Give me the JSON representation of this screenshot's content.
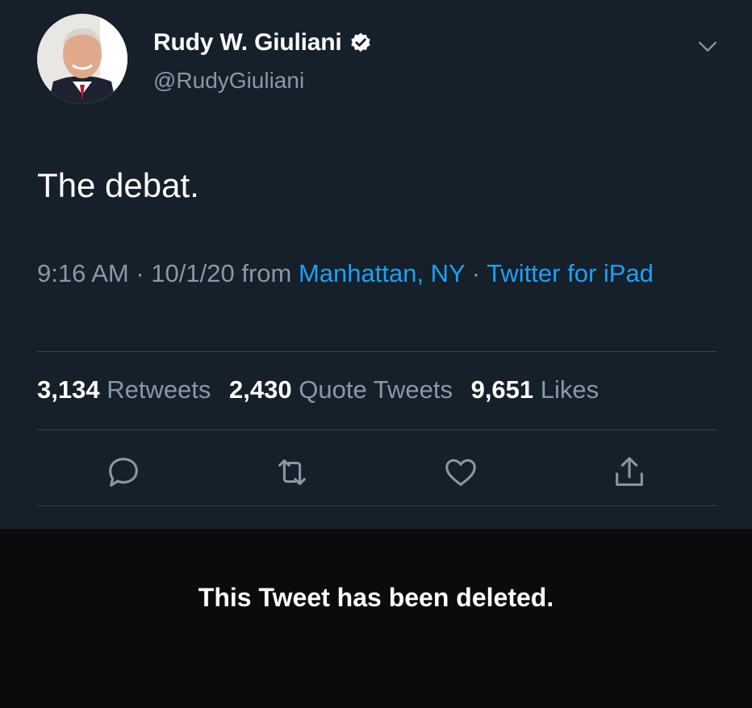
{
  "tweet": {
    "author": {
      "name": "Rudy W. Giuliani",
      "handle": "@RudyGiuliani",
      "verified": true
    },
    "text": "The debat.",
    "meta": {
      "time_date": "9:16 AM · 10/1/20 from ",
      "location": "Manhattan, NY",
      "separator": " · ",
      "source": "Twitter for iPad"
    },
    "stats": {
      "retweets_count": "3,134",
      "retweets_label": " Retweets",
      "quotes_count": "2,430",
      "quotes_label": " Quote Tweets",
      "likes_count": "9,651",
      "likes_label": " Likes"
    },
    "actions": [
      "reply-icon",
      "retweet-icon",
      "like-icon",
      "share-icon"
    ]
  },
  "notice": {
    "text": "This Tweet has been deleted."
  },
  "colors": {
    "background": "#15202b",
    "link": "#1da1f2",
    "secondary_text": "#8899a6",
    "divider": "#38444d",
    "notice_background": "#0b0b0d"
  }
}
